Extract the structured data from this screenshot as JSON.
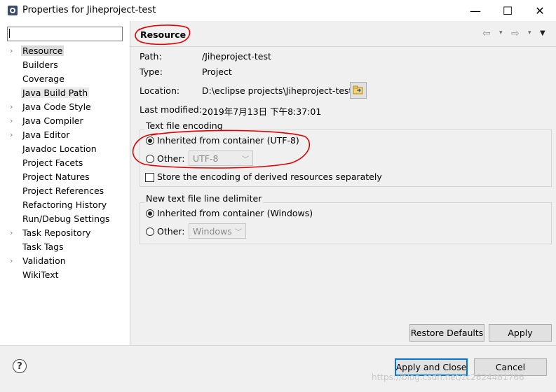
{
  "window": {
    "title": "Properties for Jiheproject-test",
    "icon": "properties-icon",
    "minimize_glyph": "—",
    "maximize_glyph": "☐",
    "close_glyph": "✕"
  },
  "sidebar": {
    "filter_placeholder": "",
    "filter_value": "",
    "items": [
      {
        "label": "Resource",
        "expandable": true,
        "selected": true
      },
      {
        "label": "Builders",
        "expandable": false
      },
      {
        "label": "Coverage",
        "expandable": false
      },
      {
        "label": "Java Build Path",
        "expandable": false,
        "highlighted": true
      },
      {
        "label": "Java Code Style",
        "expandable": true
      },
      {
        "label": "Java Compiler",
        "expandable": true
      },
      {
        "label": "Java Editor",
        "expandable": true
      },
      {
        "label": "Javadoc Location",
        "expandable": false
      },
      {
        "label": "Project Facets",
        "expandable": false
      },
      {
        "label": "Project Natures",
        "expandable": false
      },
      {
        "label": "Project References",
        "expandable": false
      },
      {
        "label": "Refactoring History",
        "expandable": false
      },
      {
        "label": "Run/Debug Settings",
        "expandable": false
      },
      {
        "label": "Task Repository",
        "expandable": true
      },
      {
        "label": "Task Tags",
        "expandable": false
      },
      {
        "label": "Validation",
        "expandable": true
      },
      {
        "label": "WikiText",
        "expandable": false
      }
    ]
  },
  "page": {
    "title": "Resource",
    "nav": {
      "back": "⇦",
      "forward": "⇨",
      "dropdown": "▾",
      "menu": "▼"
    },
    "path": {
      "label": "Path:",
      "value": "/Jiheproject-test"
    },
    "type": {
      "label": "Type:",
      "value": "Project"
    },
    "location": {
      "label": "Location:",
      "value": "D:\\eclipse projects\\Jiheproject-test"
    },
    "last_modified": {
      "label": "Last modified:",
      "value": "2019年7月13日 下午8:37:01"
    },
    "encoding": {
      "group_title": "Text file encoding",
      "inherited_label": "Inherited from container (UTF-8)",
      "other_label": "Other:",
      "other_value": "UTF-8",
      "selected": "inherited",
      "store_separately_label": "Store the encoding of derived resources separately",
      "store_separately_checked": false
    },
    "delimiter": {
      "group_title": "New text file line delimiter",
      "inherited_label": "Inherited from container (Windows)",
      "other_label": "Other:",
      "other_value": "Windows",
      "selected": "inherited"
    },
    "restore_defaults_label": "Restore Defaults",
    "apply_label": "Apply"
  },
  "footer": {
    "help_glyph": "?",
    "apply_close_label": "Apply and Close",
    "cancel_label": "Cancel",
    "watermark": "https://blog.csdn.net/zc2624481766"
  },
  "colors": {
    "annotation": "#e00000",
    "focus_border": "#0078d7",
    "panel_bg": "#f0f0f0"
  }
}
